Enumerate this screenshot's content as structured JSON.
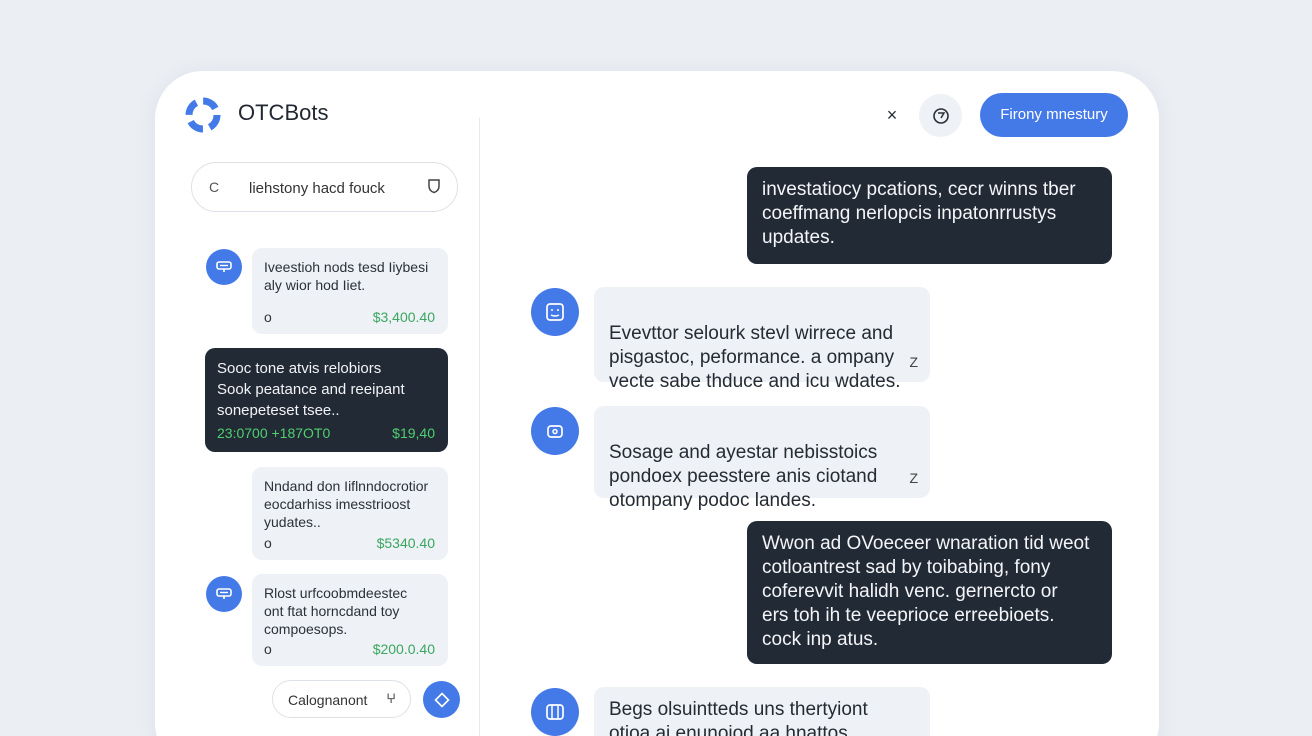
{
  "app": {
    "brand": "OTCBots"
  },
  "search": {
    "left_icon": "C",
    "text": "liehstony hacd fouck",
    "right_icon": "shield-icon"
  },
  "sidebar": {
    "cards": [
      {
        "text": "Iveestioh nods tesd Iiybesi\naly wior hod Iiet.",
        "dot": "o",
        "amount": "$3,400.40"
      },
      {
        "text": "Sooc tone atvis relobiors\nSook peatance and reeipant\nsonepeteset tsee..",
        "left": "23:0700 +187OT0",
        "amount": "$19,40"
      },
      {
        "text": "Nndand don Iiflnndocrotior\neocdarhiss imesstrioost\nyudates..",
        "dot": "o",
        "amount": "$5340.40"
      },
      {
        "text": "Rlost urfcoobmdeestec\nont ftat horncdand toy\ncompoesops.",
        "dot": "o",
        "amount": "$200.0.40"
      }
    ],
    "bottom_pill": {
      "text": "Calognanont",
      "icon": "ⵖ"
    }
  },
  "header": {
    "close_icon": "×",
    "primary_button": "Firony mnestury"
  },
  "messages": [
    {
      "type": "out",
      "text": "investatiocy pcations, cecr winns tber\ncoeffmang nerlopcis inpatonrrustys\nupdates."
    },
    {
      "type": "in",
      "text": "Evevttor selourk stevl wirrece and\npisgastoc, peformance. a ompany\nvecte sabe thduce and icu wdates.",
      "mark": "Z"
    },
    {
      "type": "in",
      "text": "Sosage and ayestar nebisstoics\npondoex peesstere anis ciotand\notompany podoc landes.",
      "mark": "Z"
    },
    {
      "type": "out",
      "text": "Wwon ad OVoeceer wnaration tid weot\ncotloantrest sad by toibabing, fony\ncoferevvit halidh venc. gernercto or\ners toh ih te veeprioce erreebioets.\ncock inp atus."
    },
    {
      "type": "in",
      "text": "Begs olsuintteds uns thertyiont\notioa ai enunoiod aa hnattos"
    }
  ],
  "colors": {
    "accent": "#4479e8",
    "dark_bubble": "#222a35",
    "amount_green": "#3aa660"
  }
}
